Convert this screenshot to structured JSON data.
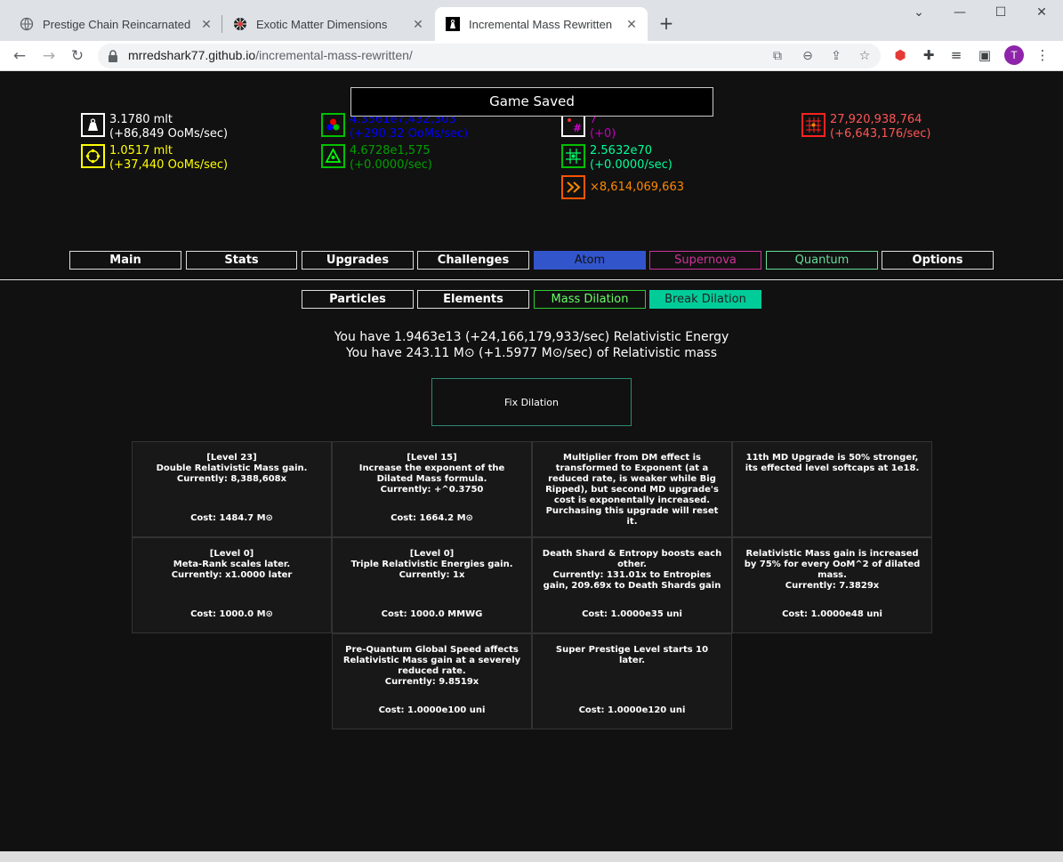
{
  "browser": {
    "tabs": [
      {
        "label": "Prestige Chain Reincarnated"
      },
      {
        "label": "Exotic Matter Dimensions"
      },
      {
        "label": "Incremental Mass Rewritten"
      }
    ],
    "url_host": "mrredshark77.github.io",
    "url_path": "/incremental-mass-rewritten/",
    "avatar_letter": "T"
  },
  "toast": "Game Saved",
  "resources": {
    "mass": {
      "value": "3.1780 mlt",
      "rate": "(+86,849 OoMs/sec)",
      "color": "#ffffff"
    },
    "rage": {
      "value": "1.0517 mlt",
      "rate": "(+37,440 OoMs/sec)",
      "color": "#ffff00"
    },
    "dark_matter": {
      "value": "4.3561e7,432,303",
      "rate": "(+290.32 OoMs/sec)",
      "color": "#0000ff"
    },
    "atom": {
      "value": "4.6728e1,575",
      "rate": "(+0.0000/sec)",
      "color": "#00a000"
    },
    "quark": {
      "value": "7",
      "rate": "(+0)",
      "color": "#c000c0"
    },
    "prestige": {
      "value": "2.5632e70",
      "rate": "(+0.0000/sec)",
      "color": "#00ff99"
    },
    "speed": {
      "value": "×8,614,069,663",
      "color": "#ff8800"
    },
    "supernova": {
      "value": "27,920,938,764",
      "rate": "(+6,643,176/sec)",
      "color": "#ff5555"
    }
  },
  "main_tabs": [
    {
      "label": "Main",
      "color": "#ffffff"
    },
    {
      "label": "Stats",
      "color": "#ffffff"
    },
    {
      "label": "Upgrades",
      "color": "#ffffff"
    },
    {
      "label": "Challenges",
      "color": "#ffffff"
    },
    {
      "label": "Atom",
      "color": "#3355cc"
    },
    {
      "label": "Supernova",
      "color": "#cc3399"
    },
    {
      "label": "Quantum",
      "color": "#66dd99"
    },
    {
      "label": "Options",
      "color": "#ffffff"
    }
  ],
  "sub_tabs": [
    {
      "label": "Particles"
    },
    {
      "label": "Elements"
    },
    {
      "label": "Mass Dilation"
    },
    {
      "label": "Break Dilation"
    }
  ],
  "energy_line": "You have 1.9463e13 (+24,166,179,933/sec) Relativistic Energy",
  "mass_line": "You have 243.11 M⊙ (+1.5977 M⊙/sec) of Relativistic mass",
  "fix_button": "Fix Dilation",
  "upgrades": [
    {
      "text": "[Level 23]\nDouble Relativistic Mass gain.\nCurrently: 8,388,608x",
      "cost": "Cost: 1484.7 M⊙"
    },
    {
      "text": "[Level 15]\nIncrease the exponent of the Dilated Mass formula.\nCurrently: +^0.3750",
      "cost": "Cost: 1664.2 M⊙"
    },
    {
      "text": "Multiplier from DM effect is transformed to Exponent (at a reduced rate, is weaker while Big Ripped), but second MD upgrade's cost is exponentally increased. Purchasing this upgrade will reset it.",
      "cost": ""
    },
    {
      "text": "11th MD Upgrade is 50% stronger, its effected level softcaps at 1e18.",
      "cost": ""
    },
    {
      "text": "[Level 0]\nMeta-Rank scales later.\nCurrently: x1.0000 later",
      "cost": "Cost: 1000.0 M⊙"
    },
    {
      "text": "[Level 0]\nTriple Relativistic Energies gain.\nCurrently: 1x",
      "cost": "Cost: 1000.0 MMWG"
    },
    {
      "text": "Death Shard & Entropy boosts each other.\nCurrently: 131.01x to Entropies gain, 209.69x to Death Shards gain",
      "cost": "Cost: 1.0000e35 uni"
    },
    {
      "text": "Relativistic Mass gain is increased by 75% for every OoM^2 of dilated mass.\nCurrently: 7.3829x",
      "cost": "Cost: 1.0000e48 uni"
    },
    {
      "text": "Pre-Quantum Global Speed affects Relativistic Mass gain at a severely reduced rate.\nCurrently: 9.8519x",
      "cost": "Cost: 1.0000e100 uni"
    },
    {
      "text": "Super Prestige Level starts 10 later.",
      "cost": "Cost: 1.0000e120 uni"
    }
  ]
}
